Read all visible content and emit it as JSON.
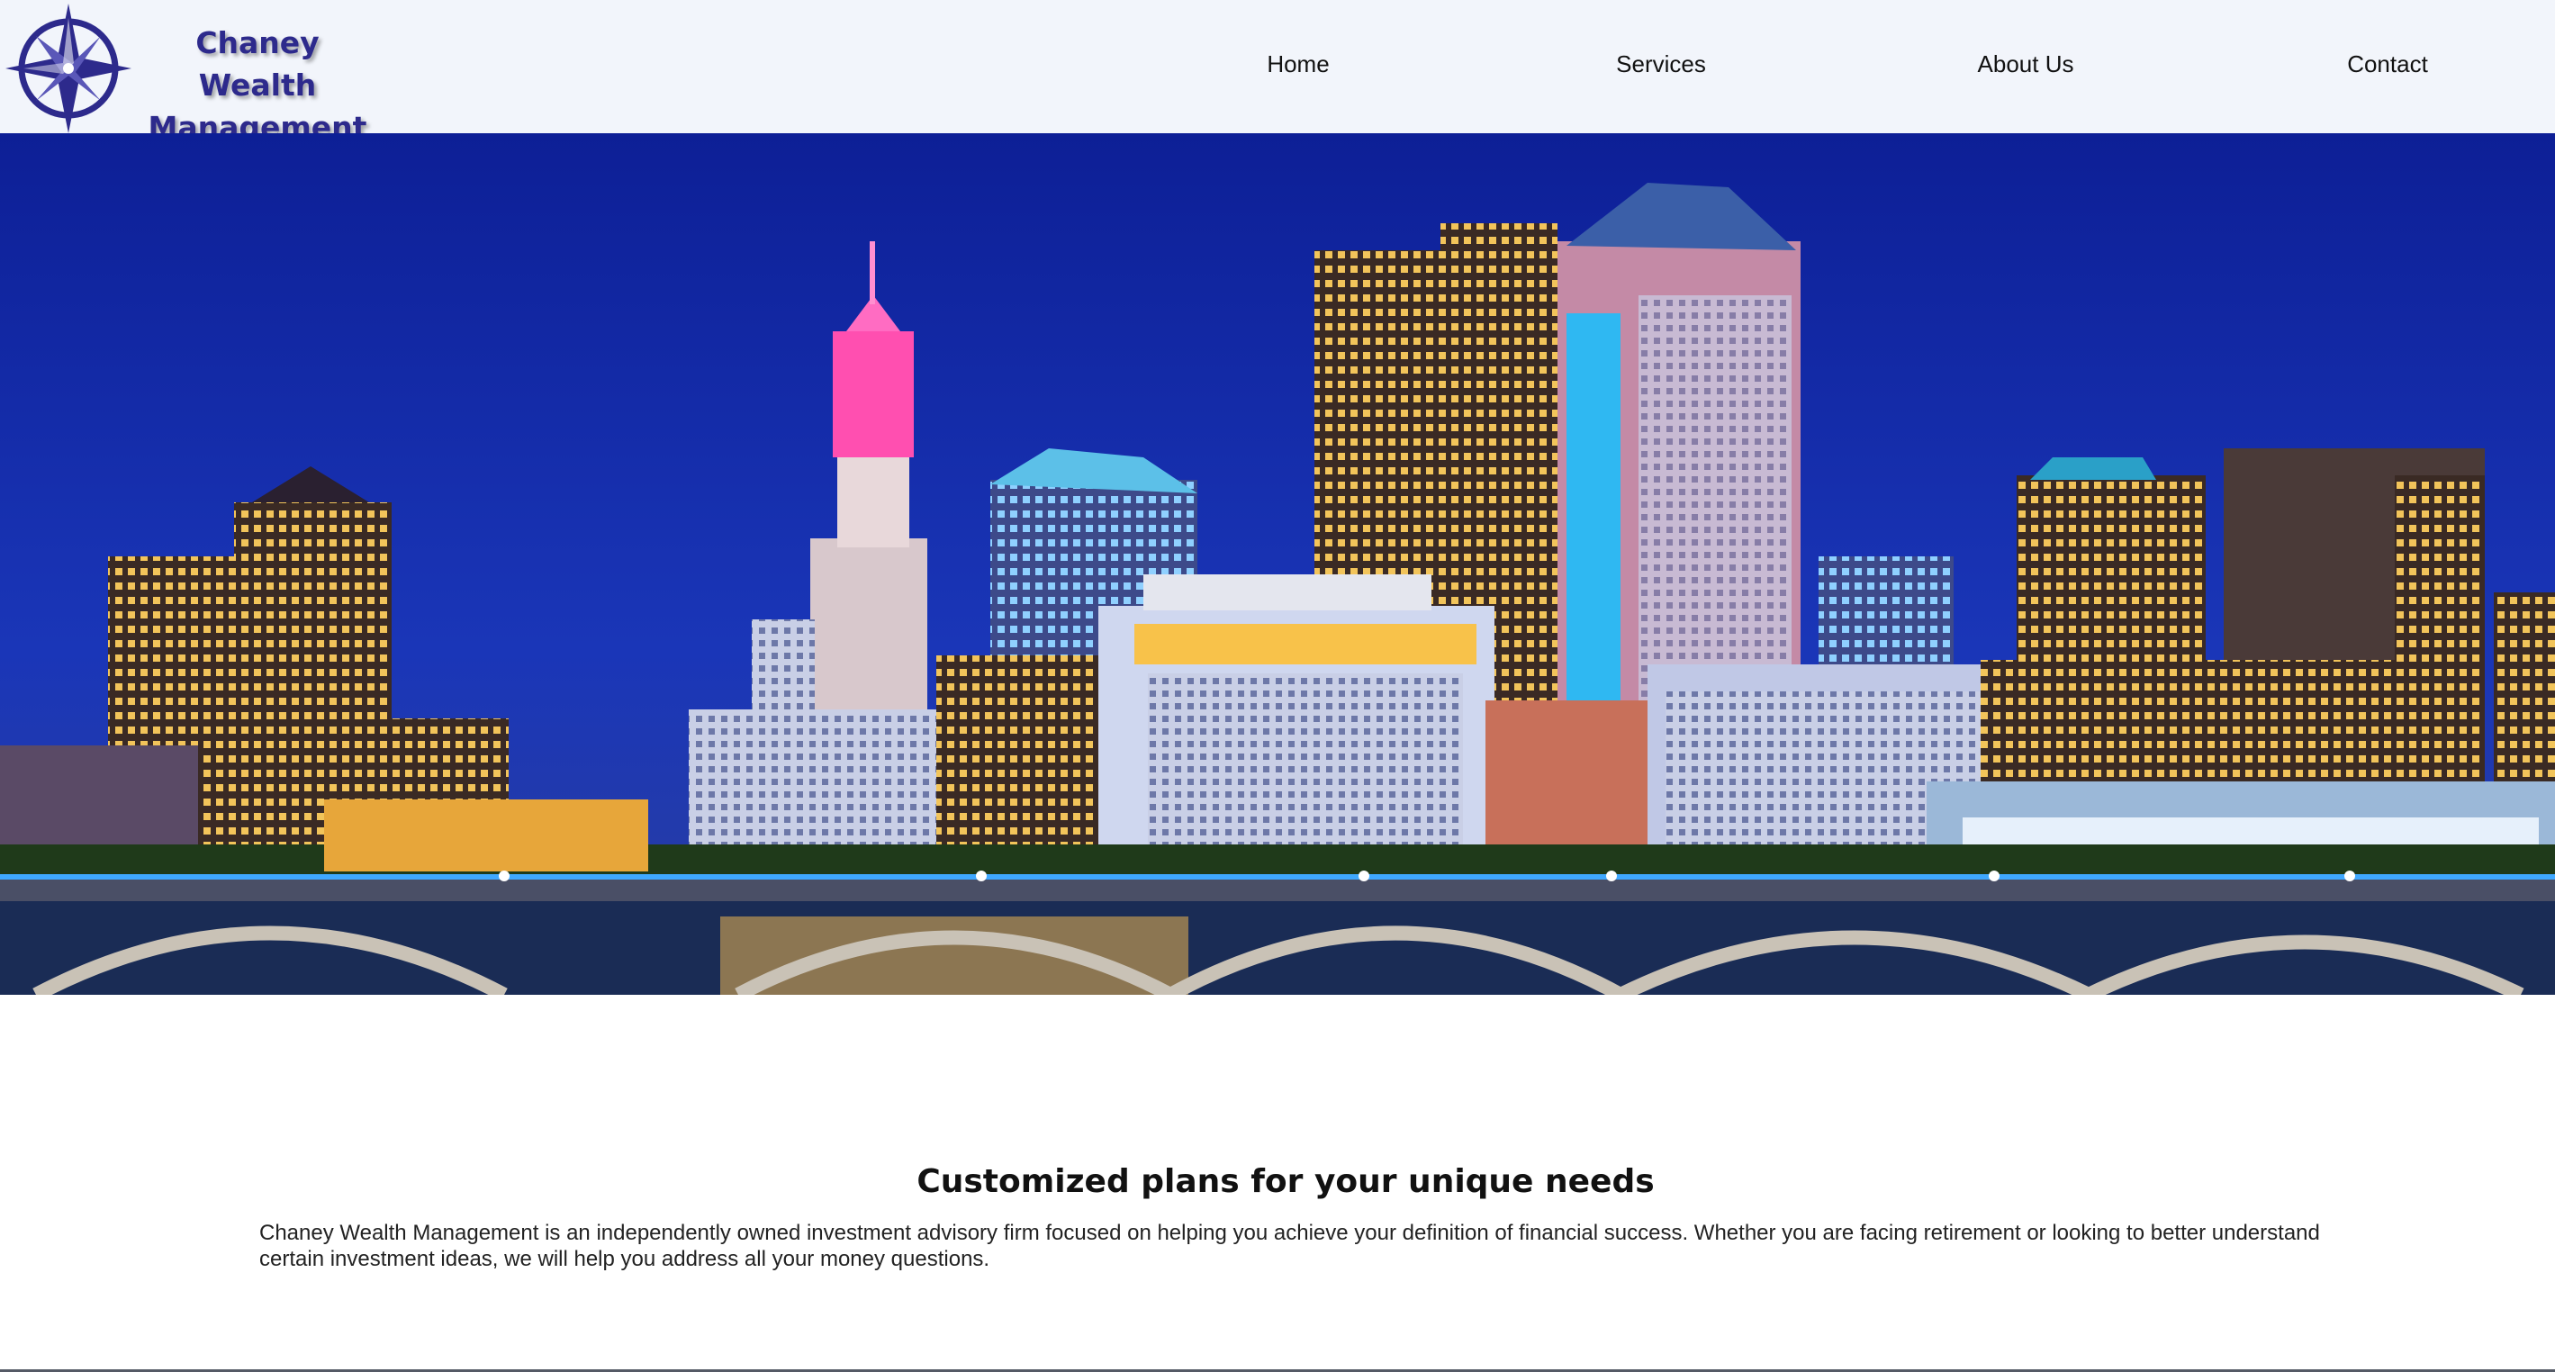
{
  "header": {
    "logo_line1": "Chaney Wealth",
    "logo_line2": "Management",
    "brand_color": "#2d2a8c"
  },
  "nav": {
    "items": [
      {
        "label": "Home"
      },
      {
        "label": "Services"
      },
      {
        "label": "About Us"
      },
      {
        "label": "Contact"
      }
    ]
  },
  "hero": {
    "image": "city-skyline-night-photo",
    "sky_color": "#1226a8"
  },
  "content": {
    "heading": "Customized plans for your unique needs",
    "paragraph": "Chaney Wealth Management is an independently owned investment advisory firm focused on helping you achieve your definition of financial success. Whether you are facing retirement or looking to better understand certain investment ideas, we will help you address all your money questions."
  }
}
